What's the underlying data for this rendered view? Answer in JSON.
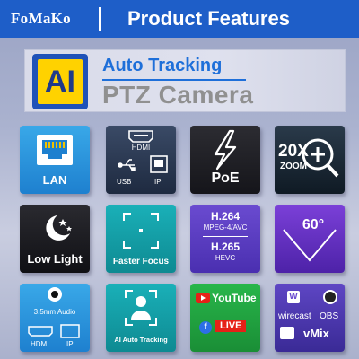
{
  "header": {
    "logo": "FoMaKo",
    "title": "Product Features"
  },
  "banner": {
    "badge": "AI",
    "line1": "Auto Tracking",
    "line2": "PTZ Camera"
  },
  "tiles": {
    "lan": {
      "label": "LAN"
    },
    "io": {
      "hdmi": "HDMI",
      "usb": "USB",
      "ip": "IP"
    },
    "poe": {
      "label": "PoE"
    },
    "zoom": {
      "big": "20X",
      "small": "ZOOM"
    },
    "lowlight": {
      "label": "Low Light"
    },
    "focus": {
      "label": "Faster Focus"
    },
    "codec": {
      "a": "H.264",
      "b": "MPEG-4/AVC",
      "c": "H.265",
      "d": "HEVC"
    },
    "angle": {
      "label": "60°"
    },
    "audio": {
      "label": "3.5mm Audio",
      "hdmi": "HDMI",
      "ip": "IP"
    },
    "aitrack": {
      "label": "AI Auto Tracking"
    },
    "stream": {
      "youtube": "YouTube",
      "live": "LIVE"
    },
    "software": {
      "wirecast": "wirecast",
      "obs": "OBS",
      "vmix": "vMix"
    }
  },
  "colors": {
    "header": "#1e5ec8",
    "accent": "#1e6fd9",
    "badge_yellow": "#ffd200"
  }
}
